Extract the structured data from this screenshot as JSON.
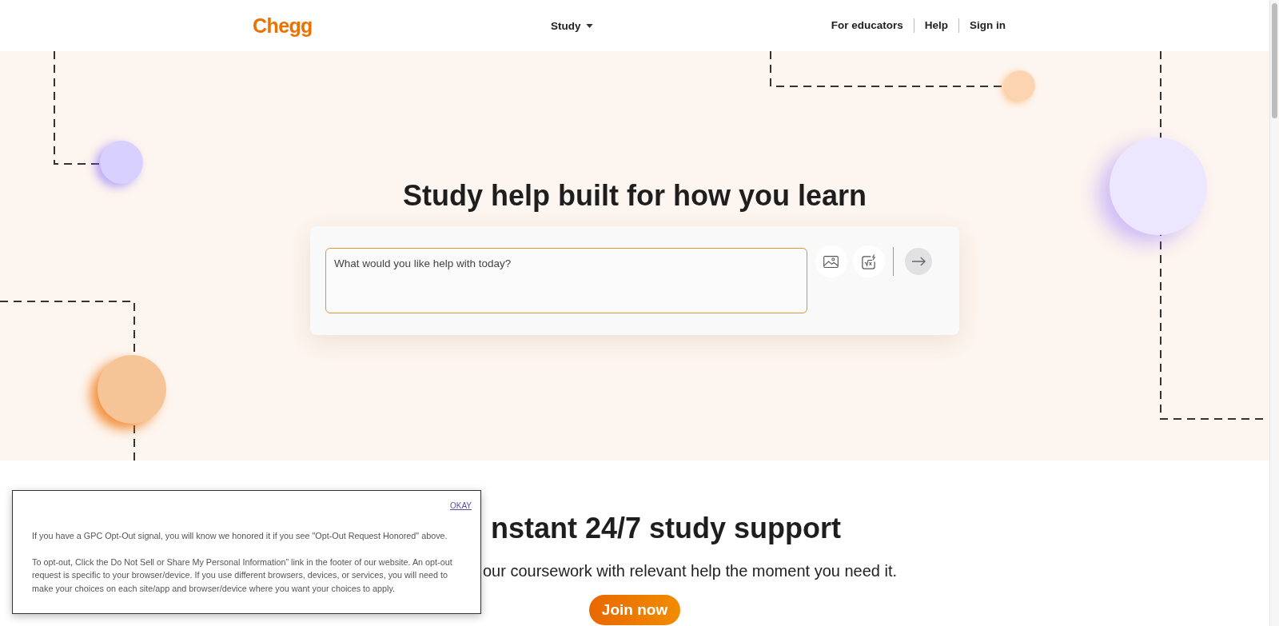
{
  "header": {
    "logo": "Chegg",
    "menu": "Study",
    "links": [
      "For educators",
      "Help",
      "Sign in"
    ]
  },
  "hero": {
    "title": "Study help built for how you learn",
    "search": {
      "placeholder": "What would you like help with today?"
    }
  },
  "support": {
    "title": "nstant 24/7 study support",
    "subtitle": "our coursework with relevant help the moment you need it.",
    "button": "Join now"
  },
  "notice": {
    "action": "OKAY",
    "paragraphs": [
      "If you have a GPC Opt-Out signal, you will know we honored it if you see \"Opt-Out Request Honored\" above.",
      "To opt-out, Click the Do Not Sell or Share My Personal Information” link in the footer of our website. An opt-out request is specific to your browser/device. If you use different browsers, devices, or services, you will need to make your choices on each site/app and browser/device where you want your choices to apply."
    ]
  }
}
